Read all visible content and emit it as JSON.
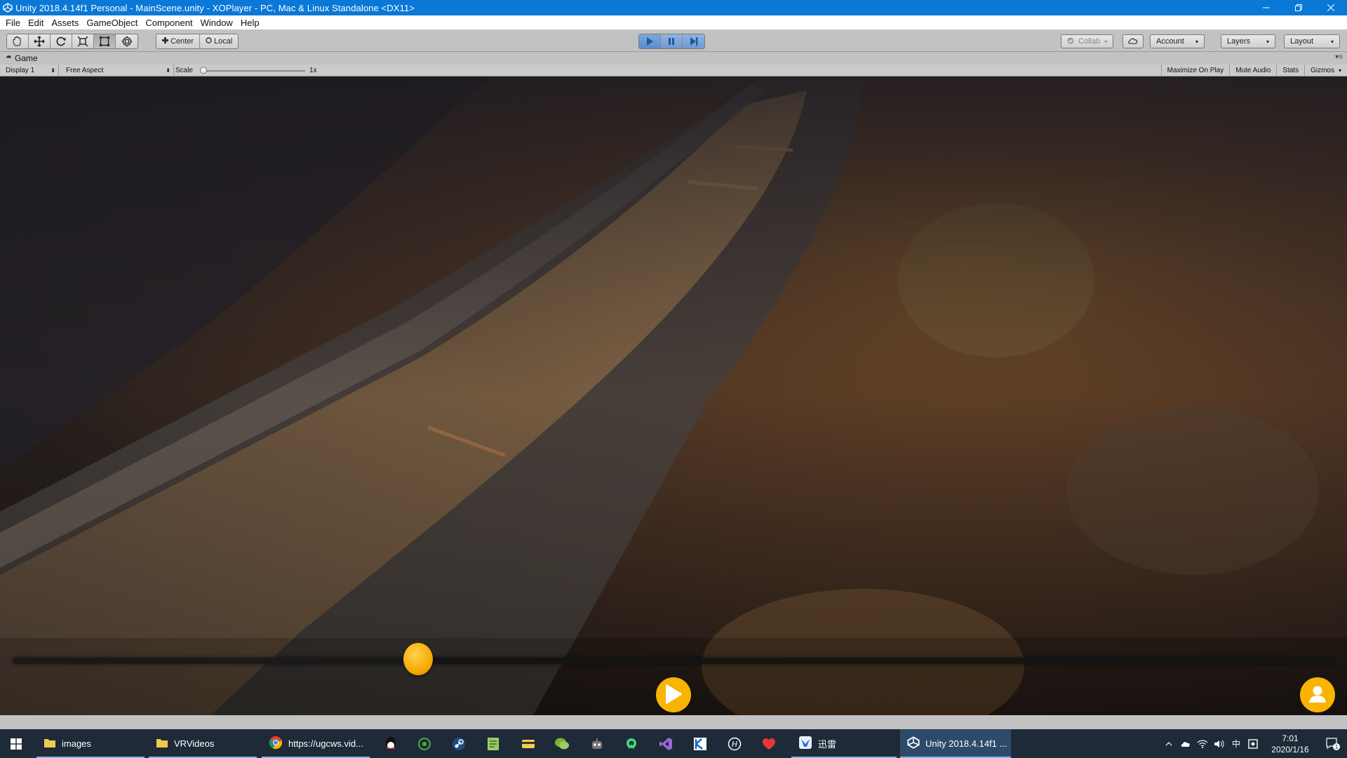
{
  "window": {
    "title": "Unity 2018.4.14f1 Personal - MainScene.unity - XOPlayer - PC, Mac & Linux Standalone <DX11>",
    "controls": [
      "minimize-icon",
      "restore-icon",
      "close-icon"
    ]
  },
  "menubar": {
    "items": [
      "File",
      "Edit",
      "Assets",
      "GameObject",
      "Component",
      "Window",
      "Help"
    ]
  },
  "toolbar": {
    "transform_tools": [
      "hand-tool-icon",
      "move-tool-icon",
      "rotate-tool-icon",
      "scale-tool-icon",
      "rect-tool-icon",
      "transform-tool-icon"
    ],
    "pivot_center_label": "Center",
    "pivot_local_label": "Local",
    "play_active": true,
    "collab_label": "Collab",
    "account_label": "Account",
    "layers_label": "Layers",
    "layout_label": "Layout"
  },
  "game_panel": {
    "tab_label": "Game",
    "display_label": "Display 1",
    "aspect_label": "Free Aspect",
    "scale_label": "Scale",
    "scale_value": "1x",
    "toggles": [
      "Maximize On Play",
      "Mute Audio",
      "Stats",
      "Gizmos"
    ]
  },
  "player": {
    "progress": 0.307,
    "play_button_icon": "play-icon",
    "user_button_icon": "user-icon",
    "accent_color": "#f8b400"
  },
  "taskbar": {
    "items": [
      {
        "label": "images",
        "icon": "folder-icon"
      },
      {
        "label": "VRVideos",
        "icon": "folder-icon"
      },
      {
        "label": "https://ugcws.vid...",
        "icon": "chrome-icon"
      }
    ],
    "pinned": [
      "qq-icon",
      "music-icon",
      "steam-icon",
      "notepad-icon",
      "pay-icon",
      "wechat-icon",
      "robot-icon",
      "android-studio-icon",
      "visual-studio-icon",
      "kotlin-icon",
      "hbuilder-icon",
      "heart-app-icon"
    ],
    "xunlei_label": "迅雷",
    "unity_label": "Unity 2018.4.14f1 ...",
    "ime_label": "中",
    "time": "7:01",
    "date": "2020/1/16",
    "notification_count": "1"
  }
}
